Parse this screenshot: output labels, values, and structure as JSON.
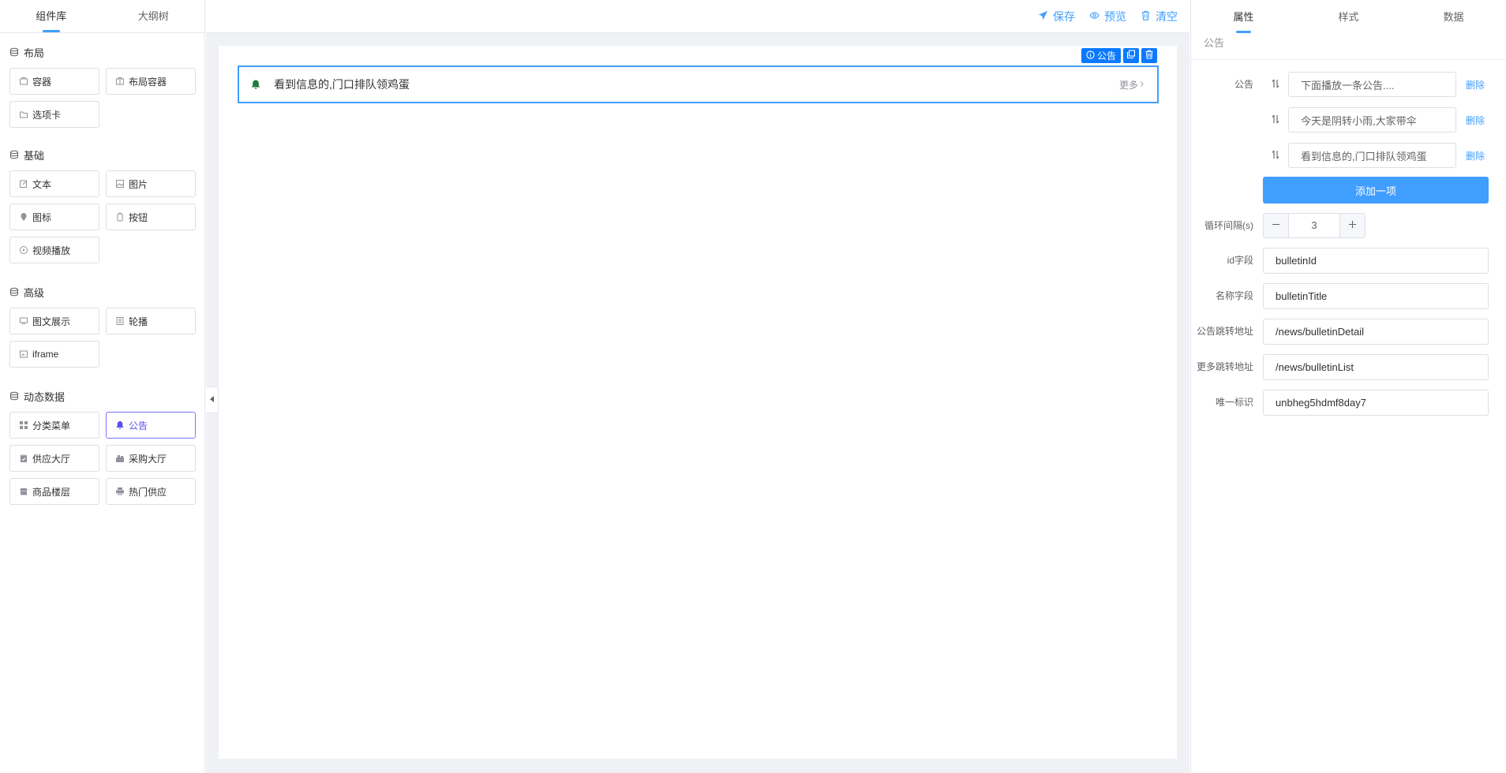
{
  "left": {
    "tabs": [
      {
        "label": "组件库"
      },
      {
        "label": "大纲树"
      }
    ],
    "groups": [
      {
        "title": "布局",
        "items": [
          {
            "label": "容器",
            "icon": "container-icon"
          },
          {
            "label": "布局容器",
            "icon": "layout-container-icon"
          },
          {
            "label": "选项卡",
            "icon": "folder-icon"
          }
        ]
      },
      {
        "title": "基础",
        "items": [
          {
            "label": "文本",
            "icon": "edit-icon"
          },
          {
            "label": "图片",
            "icon": "image-icon"
          },
          {
            "label": "图标",
            "icon": "pin-icon"
          },
          {
            "label": "按钮",
            "icon": "button-icon"
          },
          {
            "label": "视频播放",
            "icon": "video-icon"
          }
        ]
      },
      {
        "title": "高级",
        "items": [
          {
            "label": "图文展示",
            "icon": "picture-text-icon"
          },
          {
            "label": "轮播",
            "icon": "carousel-icon"
          },
          {
            "label": "iframe",
            "icon": "iframe-icon"
          }
        ]
      },
      {
        "title": "动态数据",
        "items": [
          {
            "label": "分类菜单",
            "icon": "grid-icon"
          },
          {
            "label": "公告",
            "icon": "bell-icon"
          },
          {
            "label": "供应大厅",
            "icon": "clipboard-icon"
          },
          {
            "label": "采购大厅",
            "icon": "cart-icon"
          },
          {
            "label": "商品楼层",
            "icon": "shop-icon"
          },
          {
            "label": "热门供应",
            "icon": "print-icon"
          }
        ]
      }
    ]
  },
  "toolbar": {
    "save_label": "保存",
    "preview_label": "预览",
    "clear_label": "清空"
  },
  "canvas": {
    "tag_label": "公告",
    "notice_text": "看到信息的,门口排队领鸡蛋",
    "more_label": "更多"
  },
  "right": {
    "tabs": [
      {
        "label": "属性"
      },
      {
        "label": "样式"
      },
      {
        "label": "数据"
      }
    ],
    "breadcrumb": "公告",
    "form": {
      "notice_label": "公告",
      "items": [
        {
          "value": "下面播放一条公告...."
        },
        {
          "value": "今天是阴转小雨,大家带伞"
        },
        {
          "value": "看到信息的,门口排队领鸡蛋"
        }
      ],
      "delete_label": "删除",
      "add_label": "添加一项",
      "interval_label": "循环间隔(s)",
      "interval_value": "3",
      "id_field_label": "id字段",
      "id_field_value": "bulletinId",
      "name_field_label": "名称字段",
      "name_field_value": "bulletinTitle",
      "jump_label": "公告跳转地址",
      "jump_value": "/news/bulletinDetail",
      "more_jump_label": "更多跳转地址",
      "more_jump_value": "/news/bulletinList",
      "uid_label": "唯一标识",
      "uid_value": "unbheg5hdmf8day7"
    }
  },
  "colors": {
    "accent": "#409eff",
    "tag_blue": "#0b79ff",
    "active_border": "#7b74ff",
    "canvas_bg": "#eff1f5"
  }
}
